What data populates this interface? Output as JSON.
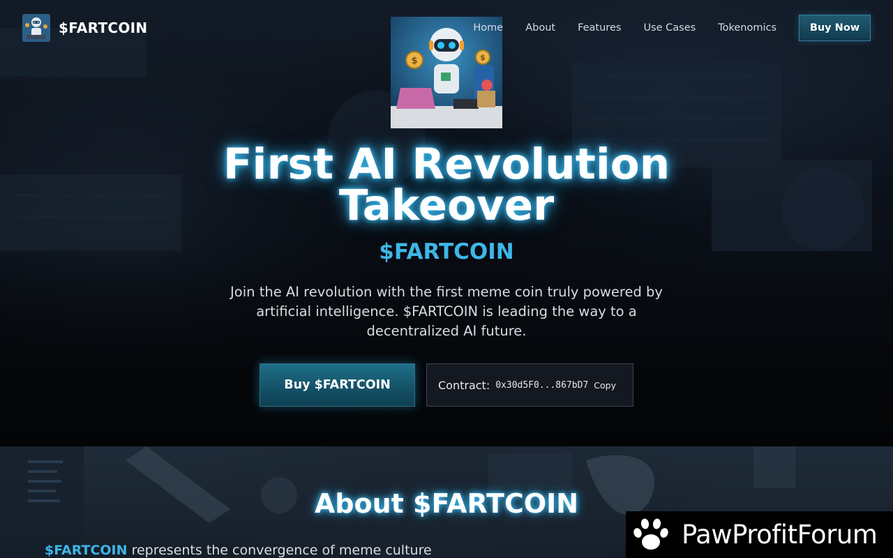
{
  "brand": {
    "name": "$FARTCOIN",
    "logo_icon": "robot-logo-icon"
  },
  "nav": {
    "items": [
      "Home",
      "About",
      "Features",
      "Use Cases",
      "Tokenomics"
    ],
    "buy_label": "Buy Now"
  },
  "hero": {
    "image_icon": "robot-trader-illustration",
    "title": "First AI Revolution Takeover",
    "subtitle": "$FARTCOIN",
    "description": "Join the AI revolution with the first meme coin truly powered by artificial intelligence. $FARTCOIN is leading the way to a decentralized AI future.",
    "buy_button": "Buy $FARTCOIN",
    "contract_label": "Contract:",
    "contract_address": "0x30d5F0...867bD7",
    "copy_label": "Copy"
  },
  "about": {
    "title": "About $FARTCOIN",
    "text_highlight": "$FARTCOIN",
    "text_rest": " represents the convergence of meme culture"
  },
  "watermark": {
    "text": "PawProfitForum",
    "icon": "paw-icon"
  },
  "colors": {
    "accent": "#3eb6e6",
    "glow": "#38bdf8",
    "button": "#1e6f88"
  }
}
